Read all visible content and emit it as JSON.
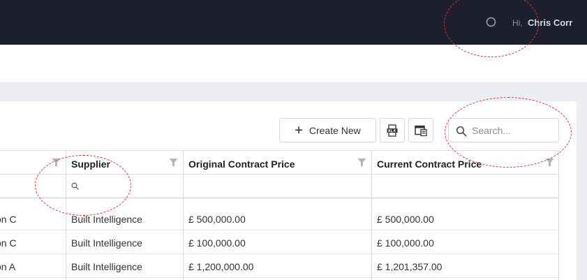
{
  "header": {
    "greeting": "Hi,",
    "username": "Chris Corr"
  },
  "toolbar": {
    "create_label": "Create New",
    "create_icon": "plus-icon",
    "export_icon": "xlsx-export-icon",
    "columns_icon": "column-chooser-icon"
  },
  "search": {
    "placeholder": "Search..."
  },
  "table": {
    "columns": [
      {
        "label": ""
      },
      {
        "label": "Supplier"
      },
      {
        "label": "Original Contract Price"
      },
      {
        "label": "Current Contract Price"
      }
    ],
    "rows": [
      [
        "on C",
        "Built Intelligence",
        "£ 500,000.00",
        "£ 500,000.00"
      ],
      [
        "on C",
        "Built Intelligence",
        "£ 100,000.00",
        "£ 100,000.00"
      ],
      [
        "on A",
        "Built Intelligence",
        "£ 1,200,000.00",
        "£ 1,201,357.00"
      ]
    ]
  },
  "colors": {
    "topbar": "#1e1f2e",
    "annotation": "#e0332f"
  }
}
